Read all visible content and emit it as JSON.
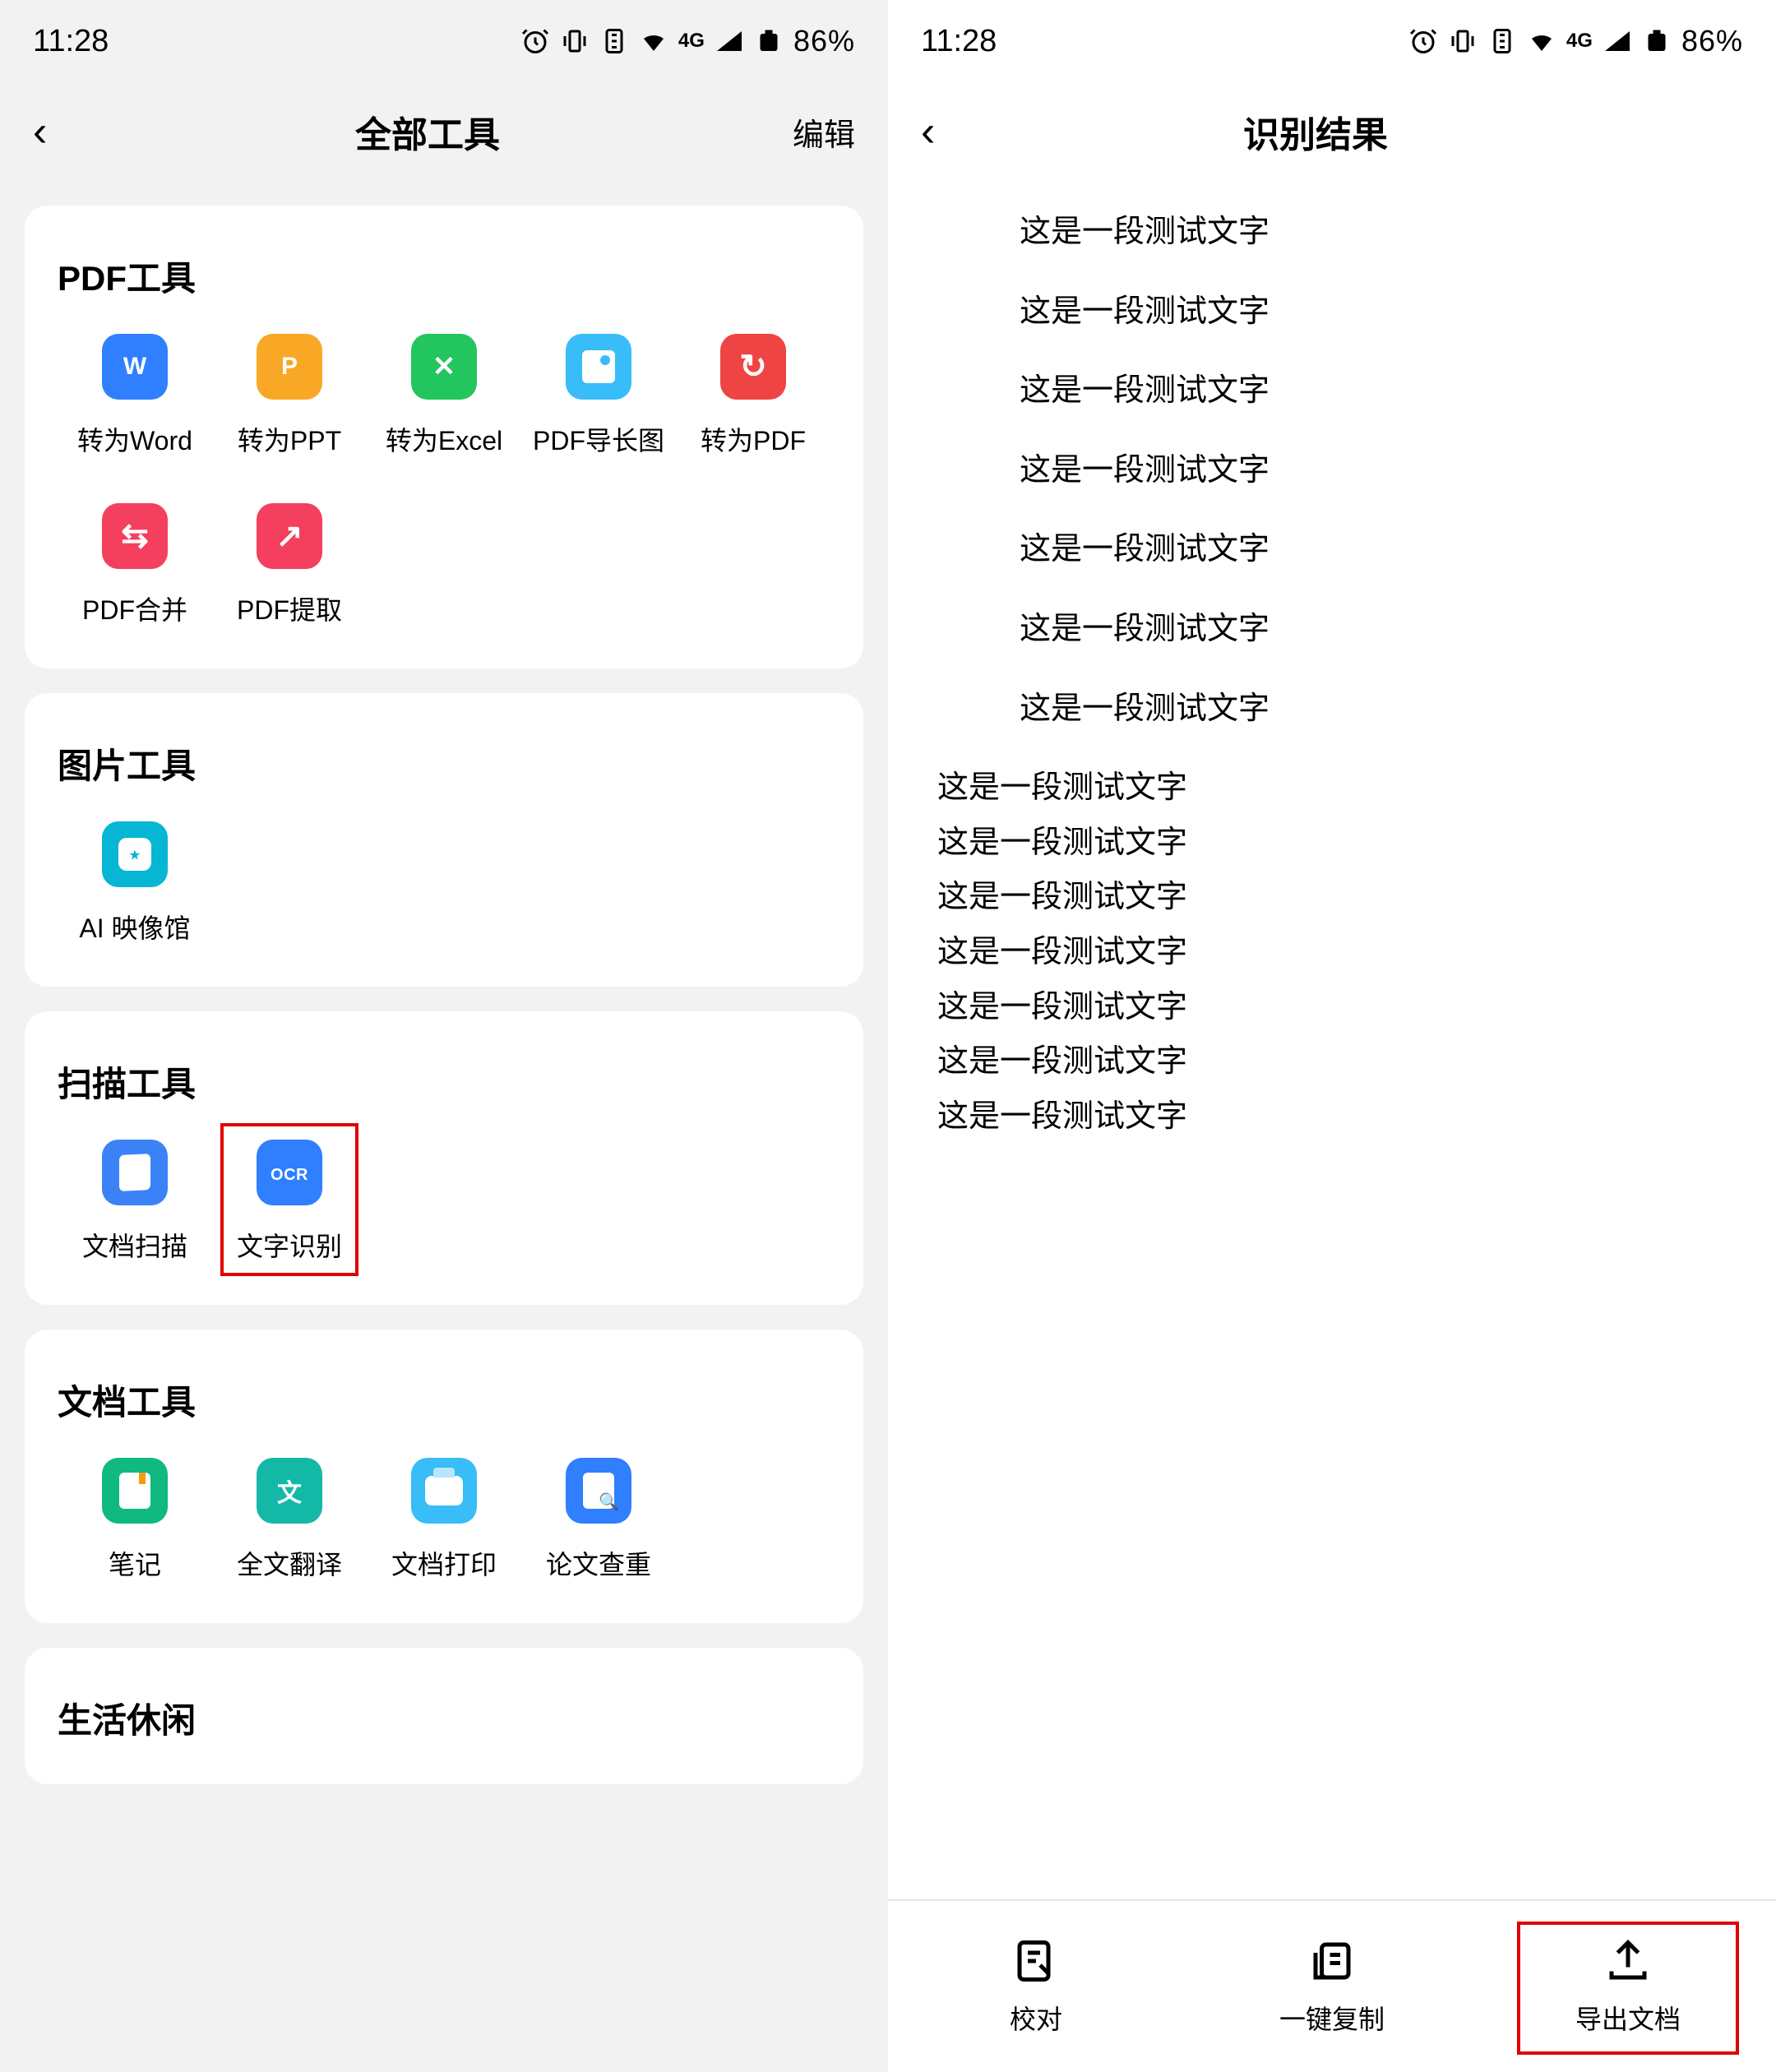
{
  "status": {
    "time": "11:28",
    "signal": "4G",
    "battery": "86%"
  },
  "left": {
    "nav": {
      "title": "全部工具",
      "action": "编辑"
    },
    "sections": [
      {
        "title": "PDF工具",
        "items": [
          "转为Word",
          "转为PPT",
          "转为Excel",
          "PDF导长图",
          "转为PDF",
          "PDF合并",
          "PDF提取"
        ]
      },
      {
        "title": "图片工具",
        "items": [
          "AI 映像馆"
        ]
      },
      {
        "title": "扫描工具",
        "items": [
          "文档扫描",
          "文字识别"
        ]
      },
      {
        "title": "文档工具",
        "items": [
          "笔记",
          "全文翻译",
          "文档打印",
          "论文查重"
        ]
      },
      {
        "title": "生活休闲",
        "items": []
      }
    ]
  },
  "right": {
    "nav": {
      "title": "识别结果"
    },
    "centered": [
      "这是一段测试文字",
      "这是一段测试文字",
      "这是一段测试文字",
      "这是一段测试文字",
      "这是一段测试文字",
      "这是一段测试文字",
      "这是一段测试文字"
    ],
    "leftAligned": [
      "这是一段测试文字",
      "这是一段测试文字",
      "这是一段测试文字",
      "这是一段测试文字",
      "这是一段测试文字",
      "这是一段测试文字",
      "这是一段测试文字"
    ],
    "bottom": [
      "校对",
      "一键复制",
      "导出文档"
    ]
  }
}
